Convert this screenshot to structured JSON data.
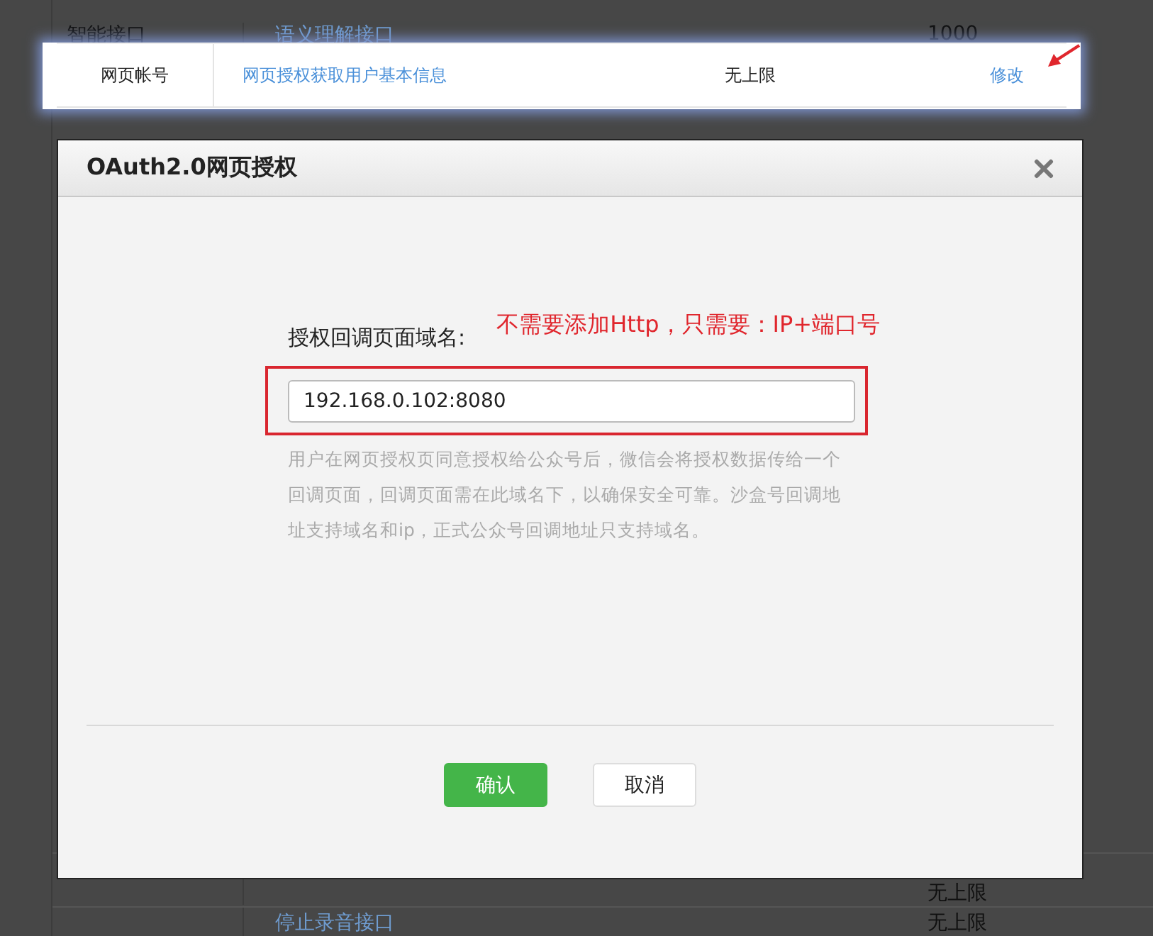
{
  "background_table": {
    "top_row": {
      "section": "智能接口",
      "name": "语义理解接口",
      "quota": "1000"
    },
    "bottom_rows": [
      {
        "quota": "无上限"
      },
      {
        "name": "停止录音接口",
        "quota": "无上限"
      }
    ]
  },
  "highlighted_row": {
    "category": "网页帐号",
    "interface": "网页授权获取用户基本信息",
    "quota": "无上限",
    "action": "修改"
  },
  "dialog": {
    "title": "OAuth2.0网页授权",
    "field_label": "授权回调页面域名:",
    "annotation": "不需要添加Http，只需要：IP+端口号",
    "field_value": "192.168.0.102:8080",
    "help": "用户在网页授权页同意授权给公众号后，微信会将授权数据传给一个回调页面，回调页面需在此域名下，以确保安全可靠。沙盒号回调地址支持域名和ip，正式公众号回调地址只支持域名。",
    "buttons": [
      {
        "label": "确认",
        "kind": "primary"
      },
      {
        "label": "取消",
        "kind": "default"
      }
    ]
  }
}
